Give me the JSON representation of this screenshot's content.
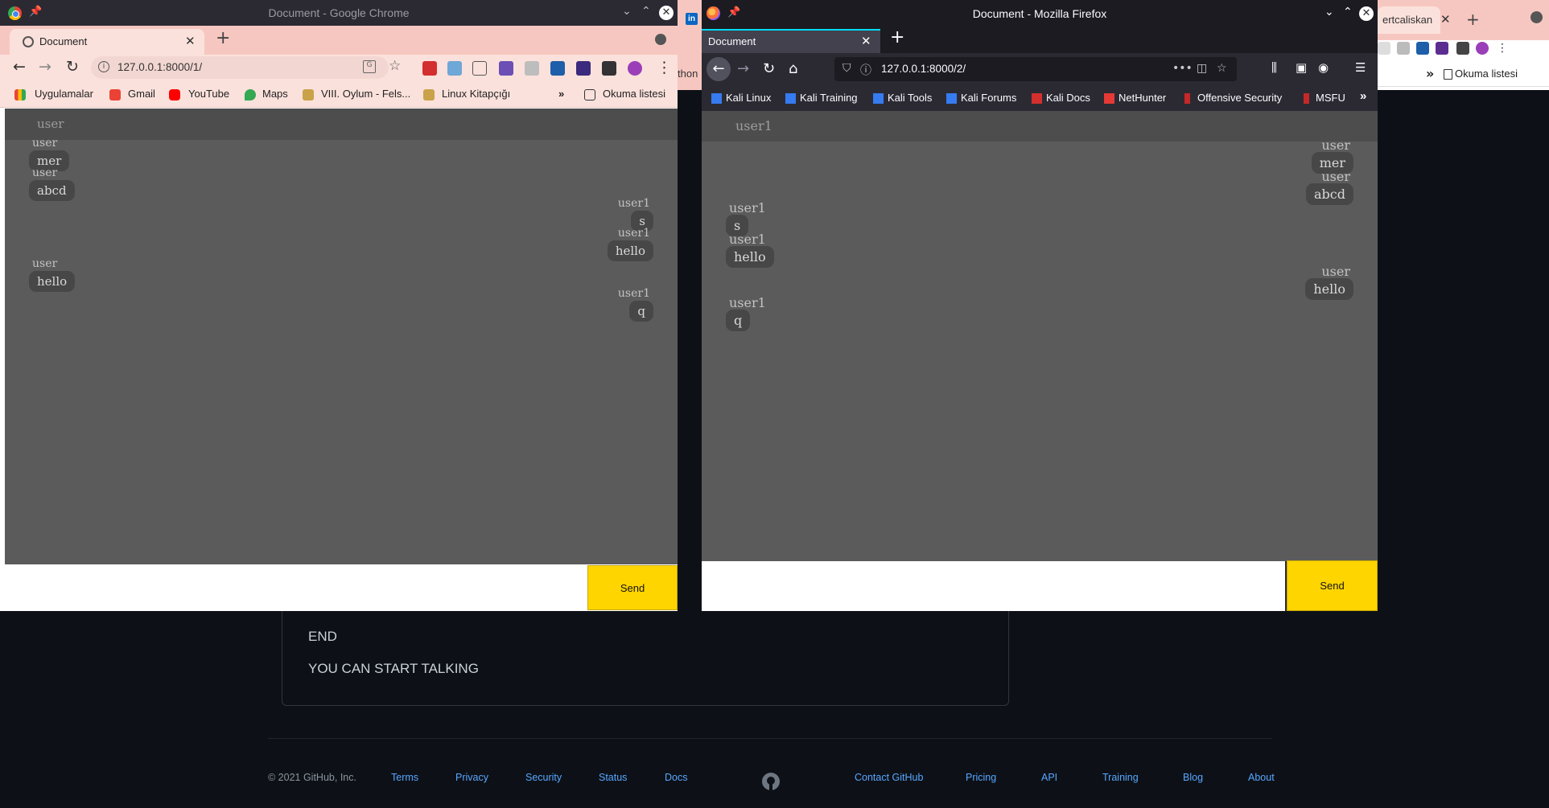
{
  "github_bg": {
    "lines": [
      "END",
      "YOU CAN START TALKING"
    ],
    "footer_copyright": "© 2021 GitHub, Inc.",
    "footer_links_left": [
      "Terms",
      "Privacy",
      "Security",
      "Status",
      "Docs"
    ],
    "footer_links_right": [
      "Contact GitHub",
      "Pricing",
      "API",
      "Training",
      "Blog",
      "About"
    ]
  },
  "peek": {
    "tab_fragment": "ertcaliskan",
    "bookmark_label": "Okuma listesi",
    "left_fragment": "thon"
  },
  "chrome": {
    "window_title": "Document - Google Chrome",
    "tab_title": "Document",
    "url": "127.0.0.1:8000/1/",
    "bookmarks": [
      "Uygulamalar",
      "Gmail",
      "YouTube",
      "Maps",
      "VIII. Oylum - Fels...",
      "Linux Kitapçığı"
    ],
    "bookmarks_overflow": "»",
    "reading_list": "Okuma listesi",
    "chat": {
      "current_user": "user",
      "messages": [
        {
          "author": "user",
          "text": "mer",
          "side": "left"
        },
        {
          "author": "user",
          "text": "abcd",
          "side": "left"
        },
        {
          "author": "user1",
          "text": "s",
          "side": "right"
        },
        {
          "author": "user1",
          "text": "hello",
          "side": "right"
        },
        {
          "author": "user",
          "text": "hello",
          "side": "left"
        },
        {
          "author": "user1",
          "text": "q",
          "side": "right"
        }
      ],
      "input_value": "",
      "send_label": "Send"
    }
  },
  "firefox": {
    "window_title": "Document - Mozilla Firefox",
    "tab_title": "Document",
    "url": "127.0.0.1:8000/2/",
    "bookmarks": [
      "Kali Linux",
      "Kali Training",
      "Kali Tools",
      "Kali Forums",
      "Kali Docs",
      "NetHunter",
      "Offensive Security",
      "MSFU"
    ],
    "chat": {
      "current_user": "user1",
      "messages": [
        {
          "author": "user",
          "text": "mer",
          "side": "right"
        },
        {
          "author": "user",
          "text": "abcd",
          "side": "right"
        },
        {
          "author": "user1",
          "text": "s",
          "side": "left"
        },
        {
          "author": "user1",
          "text": "hello",
          "side": "left"
        },
        {
          "author": "user",
          "text": "hello",
          "side": "right"
        },
        {
          "author": "user1",
          "text": "q",
          "side": "left"
        }
      ],
      "input_value": "",
      "send_label": "Send"
    }
  },
  "colors": {
    "chrome_theme": "#fbe1dc",
    "chat_bg": "#5b5b5b",
    "bubble_bg": "#474747",
    "send_bg": "#ffd500",
    "github_bg": "#0d1117",
    "github_link": "#58a6ff"
  }
}
